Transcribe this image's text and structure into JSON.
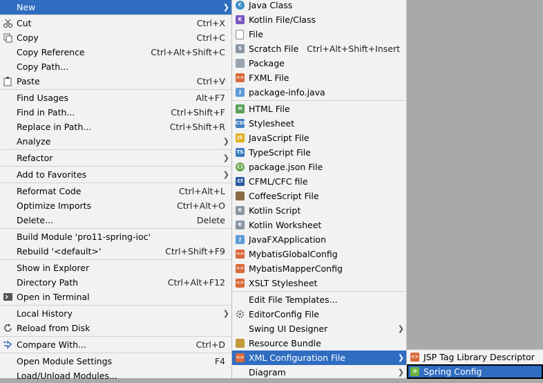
{
  "main_menu": {
    "items": [
      {
        "label": "New",
        "shortcut": "",
        "submenu": true,
        "icon": "new-icon"
      },
      {
        "label": "Cut",
        "shortcut": "Ctrl+X",
        "icon": "scissors-icon"
      },
      {
        "label": "Copy",
        "shortcut": "Ctrl+C",
        "icon": "copy-icon"
      },
      {
        "label": "Copy Reference",
        "shortcut": "Ctrl+Alt+Shift+C"
      },
      {
        "label": "Copy Path...",
        "shortcut": ""
      },
      {
        "label": "Paste",
        "shortcut": "Ctrl+V",
        "icon": "paste-icon"
      },
      {
        "label": "Find Usages",
        "shortcut": "Alt+F7"
      },
      {
        "label": "Find in Path...",
        "shortcut": "Ctrl+Shift+F"
      },
      {
        "label": "Replace in Path...",
        "shortcut": "Ctrl+Shift+R"
      },
      {
        "label": "Analyze",
        "shortcut": "",
        "submenu": true
      },
      {
        "label": "Refactor",
        "shortcut": "",
        "submenu": true
      },
      {
        "label": "Add to Favorites",
        "shortcut": "",
        "submenu": true
      },
      {
        "label": "Reformat Code",
        "shortcut": "Ctrl+Alt+L"
      },
      {
        "label": "Optimize Imports",
        "shortcut": "Ctrl+Alt+O"
      },
      {
        "label": "Delete...",
        "shortcut": "Delete"
      },
      {
        "label": "Build Module 'pro11-spring-ioc'",
        "shortcut": ""
      },
      {
        "label": "Rebuild '<default>'",
        "shortcut": "Ctrl+Shift+F9"
      },
      {
        "label": "Show in Explorer",
        "shortcut": ""
      },
      {
        "label": "Directory Path",
        "shortcut": "Ctrl+Alt+F12"
      },
      {
        "label": "Open in Terminal",
        "shortcut": "",
        "icon": "terminal-icon"
      },
      {
        "label": "Local History",
        "shortcut": "",
        "submenu": true
      },
      {
        "label": "Reload from Disk",
        "shortcut": "",
        "icon": "reload-icon"
      },
      {
        "label": "Compare With...",
        "shortcut": "Ctrl+D",
        "icon": "compare-icon"
      },
      {
        "label": "Open Module Settings",
        "shortcut": "F4"
      },
      {
        "label": "Load/Unload Modules...",
        "shortcut": ""
      }
    ]
  },
  "new_menu": {
    "items": [
      {
        "label": "Java Class",
        "shortcut": ""
      },
      {
        "label": "Kotlin File/Class",
        "shortcut": ""
      },
      {
        "label": "File",
        "shortcut": ""
      },
      {
        "label": "Scratch File",
        "shortcut": "Ctrl+Alt+Shift+Insert"
      },
      {
        "label": "Package",
        "shortcut": ""
      },
      {
        "label": "FXML File",
        "shortcut": ""
      },
      {
        "label": "package-info.java",
        "shortcut": ""
      },
      {
        "label": "HTML File",
        "shortcut": ""
      },
      {
        "label": "Stylesheet",
        "shortcut": ""
      },
      {
        "label": "JavaScript File",
        "shortcut": ""
      },
      {
        "label": "TypeScript File",
        "shortcut": ""
      },
      {
        "label": "package.json File",
        "shortcut": ""
      },
      {
        "label": "CFML/CFC file",
        "shortcut": ""
      },
      {
        "label": "CoffeeScript File",
        "shortcut": ""
      },
      {
        "label": "Kotlin Script",
        "shortcut": ""
      },
      {
        "label": "Kotlin Worksheet",
        "shortcut": ""
      },
      {
        "label": "JavaFXApplication",
        "shortcut": ""
      },
      {
        "label": "MybatisGlobalConfig",
        "shortcut": ""
      },
      {
        "label": "MybatisMapperConfig",
        "shortcut": ""
      },
      {
        "label": "XSLT Stylesheet",
        "shortcut": ""
      },
      {
        "label": "Edit File Templates...",
        "shortcut": ""
      },
      {
        "label": "EditorConfig File",
        "shortcut": ""
      },
      {
        "label": "Swing UI Designer",
        "shortcut": ""
      },
      {
        "label": "Resource Bundle",
        "shortcut": ""
      },
      {
        "label": "XML Configuration File",
        "shortcut": ""
      },
      {
        "label": "Diagram",
        "shortcut": ""
      }
    ]
  },
  "xml_menu": {
    "items": [
      {
        "label": "JSP Tag Library Descriptor"
      },
      {
        "label": "Spring Config"
      }
    ]
  },
  "colors": {
    "selection": "#2f6dc1",
    "menu_bg": "#f2f2f2",
    "backdrop": "#a9a9a9"
  }
}
